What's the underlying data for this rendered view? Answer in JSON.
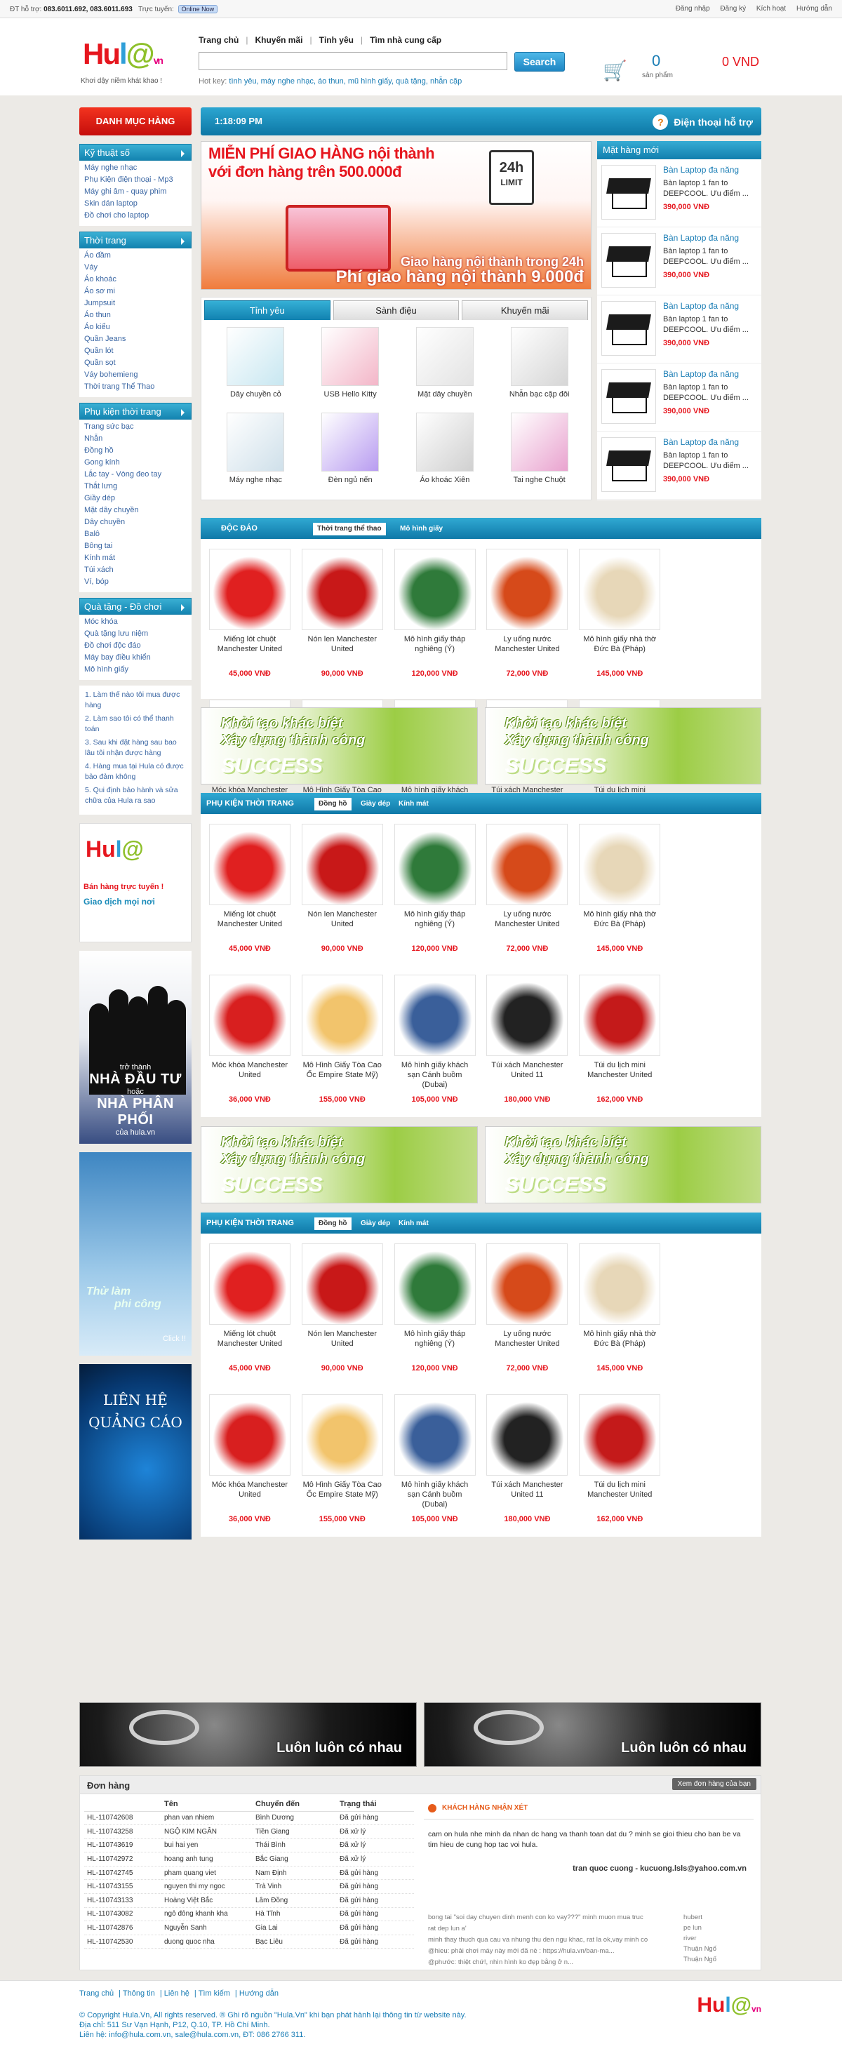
{
  "topbar": {
    "support_label": "ĐT hỗ trợ:",
    "support_phone": "083.6011.692, 083.6011.693",
    "online_label": "Trực tuyến:",
    "online_badge": "Online Now",
    "links": [
      "Đăng nhập",
      "Đăng ký",
      "Kích hoạt",
      "Hướng dẫn"
    ]
  },
  "header": {
    "logo": [
      "Hu",
      "l",
      "@",
      "vn"
    ],
    "slogan": "Khơi dậy niềm khát khao !",
    "nav": [
      "Trang chủ",
      "Khuyến mãi",
      "Tỉnh yêu",
      "Tìm nhà cung cấp"
    ],
    "search_placeholder": "",
    "search_button": "Search",
    "hotkey_label": "Hot key:",
    "hotkey_terms": "tình yêu, máy nghe nhạc, áo thun, mũ hình giấy, quà tặng, nhẫn cặp",
    "cart_count": "0",
    "cart_label": "sản phẩm",
    "cart_total": "0 VND",
    "cart_icon": "shopping-cart-icon"
  },
  "sidebar": {
    "category_button": "DANH MỤC HÀNG",
    "sections": [
      {
        "title": "Kỹ thuật số",
        "items": [
          "Máy nghe nhạc",
          "Phụ Kiện điện thoại - Mp3",
          "Máy ghi âm - quay phim",
          "Skin dán laptop",
          "Đồ chơi cho laptop"
        ]
      },
      {
        "title": "Thời trang",
        "items": [
          "Áo đầm",
          "Váy",
          "Áo khoác",
          "Áo sơ mi",
          "Jumpsuit",
          "Áo thun",
          "Áo kiểu",
          "Quần Jeans",
          "Quần lót",
          "Quần sọt",
          "Váy bohemieng",
          "Thời trang Thể Thao"
        ]
      },
      {
        "title": "Phụ kiện thời trang",
        "items": [
          "Trang sức bạc",
          "Nhẫn",
          "Đồng hồ",
          "Gong kính",
          "Lắc tay - Vòng đeo tay",
          "Thắt lưng",
          "Giầy dép",
          "Mặt dây chuyền",
          "Dây chuyền",
          "Balô",
          "Bông tai",
          "Kính mát",
          "Túi xách",
          "Ví, bóp"
        ]
      },
      {
        "title": "Quà tặng - Đồ chơi",
        "items": [
          "Móc khóa",
          "Quà tặng lưu niệm",
          "Đồ chơi độc đáo",
          "Máy bay điều khiển",
          "Mô hình giấy"
        ]
      }
    ],
    "faq": [
      "1. Làm thế nào tôi mua được hàng",
      "2. Làm sao tôi có thể thanh toán",
      "3. Sau khi đặt hàng sau bao lâu tôi nhận được hàng",
      "4. Hàng mua tại Hula có được bảo đảm không",
      "5. Qui định bảo hành và sửa chữa của Hula ra sao"
    ],
    "ad1": {
      "title": "Bán hàng trực tuyến !",
      "subtitle": "Giao dịch mọi nơi"
    },
    "ad2": {
      "pre": "trở thành",
      "main": "NHÀ ĐẦU TƯ",
      "mid": "hoặc",
      "main2": "NHÀ PHÂN PHỐI",
      "post": "của hula.vn"
    },
    "ad3": {
      "line1": "Thử làm",
      "line2": "phi công",
      "click": "Click !!"
    },
    "ad4": {
      "line1": "LIÊN HỆ",
      "line2": "QUẢNG CÁO"
    }
  },
  "clockbar": {
    "time": "1:18:09 PM",
    "hotline": "Điện thoại hỗ trợ"
  },
  "banner": {
    "line1": "MIỄN PHÍ GIAO HÀNG nội thành",
    "line2": "với đơn hàng trên 500.000đ",
    "line3": "Giao hàng nội thành trong 24h",
    "line4": "Phí giao hàng nội thành 9.000đ",
    "sign_main": "24h",
    "sign_sub": "LIMIT"
  },
  "tabs": {
    "labels": [
      "Tỉnh yêu",
      "Sành điệu",
      "Khuyến mãi"
    ],
    "items": [
      "Dây chuyền cỏ",
      "USB Hello Kitty",
      "Mặt dây chuyền",
      "Nhẫn bạc cặp đôi",
      "Máy nghe nhạc",
      "Đèn ngủ nến",
      "Áo khoác Xiên",
      "Tai nghe Chuột"
    ]
  },
  "newproducts": {
    "title": "Mặt hàng mới",
    "items": [
      {
        "name": "Bàn Laptop đa năng",
        "desc": "Bàn laptop 1 fan to DEEPCOOL. Ưu điểm ...",
        "price": "390,000 VNĐ"
      },
      {
        "name": "Bàn Laptop đa năng",
        "desc": "Bàn laptop 1 fan to DEEPCOOL. Ưu điểm ...",
        "price": "390,000 VNĐ"
      },
      {
        "name": "Bàn Laptop đa năng",
        "desc": "Bàn laptop 1 fan to DEEPCOOL. Ưu điểm ...",
        "price": "390,000 VNĐ"
      },
      {
        "name": "Bàn Laptop đa năng",
        "desc": "Bàn laptop 1 fan to DEEPCOOL. Ưu điểm ...",
        "price": "390,000 VNĐ"
      },
      {
        "name": "Bàn Laptop đa năng",
        "desc": "Bàn laptop 1 fan to DEEPCOOL. Ưu điểm ...",
        "price": "390,000 VNĐ"
      }
    ]
  },
  "sections": [
    {
      "title": "ĐỘC ĐÁO",
      "subs": [
        "Thời trang thể thao",
        "Mô hình giấy"
      ]
    },
    {
      "title": "PHỤ KIỆN THỜI TRANG",
      "subs": [
        "Đồng hồ",
        "Giày dép",
        "Kính mát"
      ]
    },
    {
      "title": "PHỤ KIỆN THỜI TRANG",
      "subs": [
        "Đồng hồ",
        "Giày dép",
        "Kính mát"
      ]
    }
  ],
  "products": [
    {
      "name": "Miếng lót chuột Manchester United",
      "price": "45,000 VNĐ"
    },
    {
      "name": "Nón len Manchester United",
      "price": "90,000 VNĐ"
    },
    {
      "name": "Mô hình giấy tháp nghiêng (Ý)",
      "price": "120,000 VNĐ"
    },
    {
      "name": "Ly uống nước Manchester United",
      "price": "72,000 VNĐ"
    },
    {
      "name": "Mô hình giấy nhà thờ Đức Bà (Pháp)",
      "price": "145,000 VNĐ"
    },
    {
      "name": "",
      "price": ""
    },
    {
      "name": "Móc khóa Manchester United",
      "price": "36,000 VNĐ"
    },
    {
      "name": "Mô Hình Giấy Tòa Cao Ốc Empire State Mỹ)",
      "price": "155,000 VNĐ"
    },
    {
      "name": "Mô hình giấy khách sạn Cánh buồm (Dubai)",
      "price": "105,000 VNĐ"
    },
    {
      "name": "Túi xách Manchester United 11",
      "price": "180,000 VNĐ"
    },
    {
      "name": "Túi du lịch mini Manchester United",
      "price": "162,000 VNĐ"
    },
    {
      "name": "",
      "price": ""
    }
  ],
  "adstrip": {
    "line1": "Khởi tạo khác biệt",
    "line2": "Xây dựng thành công",
    "big": "SUCCESS"
  },
  "footbanner": {
    "text": "Luôn luôn có nhau"
  },
  "orders": {
    "title": "Đơn hàng",
    "button": "Xem đơn hàng của bạn",
    "headers": [
      "",
      "Tên",
      "Chuyển đến",
      "Trạng thái"
    ],
    "rows": [
      [
        "HL-110742608",
        "phan van nhiem",
        "Bình Dương",
        "Đã gửi hàng"
      ],
      [
        "HL-110743258",
        "NGỘ KIM NGÂN",
        "Tiền Giang",
        "Đã xử lý"
      ],
      [
        "HL-110743619",
        "bui hai yen",
        "Thái Bình",
        "Đã xử lý"
      ],
      [
        "HL-110742972",
        "hoang anh tung",
        "Bắc Giang",
        "Đã xử lý"
      ],
      [
        "HL-110742745",
        "pham quang viet",
        "Nam Định",
        "Đã gửi hàng"
      ],
      [
        "HL-110743155",
        "nguyen thi my ngoc",
        "Trà Vinh",
        "Đã gửi hàng"
      ],
      [
        "HL-110743133",
        "Hoàng Việt Bắc",
        "Lâm Đồng",
        "Đã gửi hàng"
      ],
      [
        "HL-110743082",
        "ngô đông khanh kha",
        "Hà Tĩnh",
        "Đã gửi hàng"
      ],
      [
        "HL-110742876",
        "Nguyễn Sanh",
        "Gia Lai",
        "Đã gửi hàng"
      ],
      [
        "HL-110742530",
        "duong quoc nha",
        "Bạc Liêu",
        "Đã gửi hàng"
      ]
    ]
  },
  "review": {
    "title": "KHÁCH HÀNG NHẬN XÉT",
    "message": "cam on hula nhe minh da nhan dc hang va thanh toan dat du ? minh se gioi thieu cho ban be va tim hieu de cung hop tac voi hula.",
    "author": "tran quoc cuong - kucuong.lsls@yahoo.com.vn",
    "chat": [
      "bong tai \"soi day chuyen dinh menh con ko vay???\" minh muon mua truc",
      "rat dep lun a'",
      "minh thay thuch qua cau va nhung thu den ngu khac, rat la ok,vay minh co",
      "@hieu: phải chơi máy này mới đã nè : https://hula.vn/ban-ma...",
      "@phước: thiệt chứ!, nhìn hình ko đẹp bằng ở n..."
    ],
    "names": [
      "hubert",
      "pe lun",
      "river",
      "Thuận Ngố",
      "Thuận Ngố"
    ]
  },
  "footer": {
    "links": [
      "Trang chủ",
      "Thông tin",
      "Liên hệ",
      "Tìm kiếm",
      "Hướng dẫn"
    ],
    "copyright": "© Copyright Hula.Vn, All rights reserved. ® Ghi rõ nguồn \"Hula.Vn\" khi bạn phát hành lại thông tin từ website này.",
    "address": "Địa chỉ: 511 Sư Vạn Hạnh, P12, Q.10, TP. Hồ Chí Minh.",
    "contact": "Liên hệ: info@hula.com.vn, sale@hula.com.vn, ĐT: 086 2766 311."
  },
  "colors": {
    "accent": "#1484b1",
    "red": "#e6161e",
    "bg": "#eceae6"
  }
}
